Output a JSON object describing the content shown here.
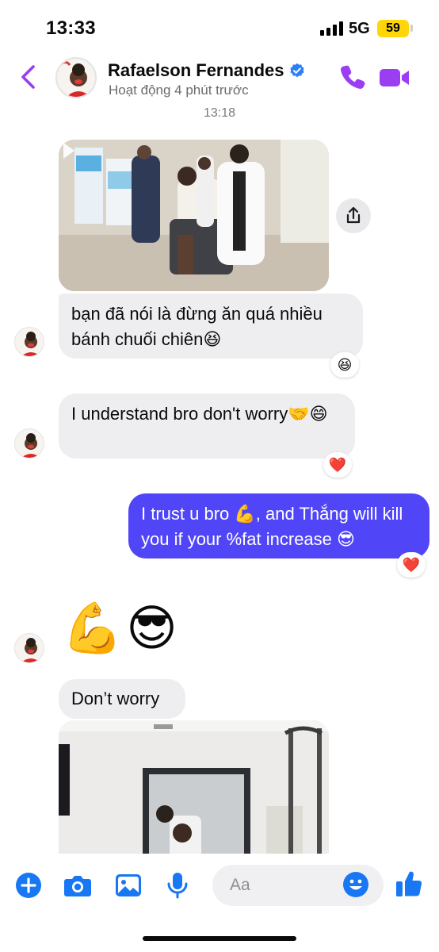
{
  "status_bar": {
    "time": "13:33",
    "network": "5G",
    "battery": "59"
  },
  "header": {
    "contact_name": "Rafaelson Fernandes",
    "presence": "Hoạt động 4 phút trước",
    "icons": [
      "chevron-left-icon",
      "verified-badge-icon",
      "phone-icon",
      "video-camera-icon"
    ]
  },
  "conversation": {
    "timestamp": "13:18",
    "messages": [
      {
        "type": "photo",
        "sender": "contact"
      },
      {
        "type": "text",
        "sender": "contact",
        "text": "bạn đã nói là đừng ăn quá nhiều bánh chuối chiên😆",
        "reaction": "😆"
      },
      {
        "type": "text",
        "sender": "contact",
        "text": "I understand bro don't worry🤝😄",
        "reaction": "❤️"
      },
      {
        "type": "text",
        "sender": "me",
        "text": "I trust u bro 💪, and Thắng will kill you if your %fat increase 😎",
        "reaction": "❤️"
      },
      {
        "type": "emoji",
        "sender": "contact",
        "text": "💪😎"
      },
      {
        "type": "text",
        "sender": "contact",
        "text": "Don’t worry"
      },
      {
        "type": "photo",
        "sender": "contact"
      }
    ]
  },
  "composer": {
    "placeholder": "Aa",
    "icons": [
      "plus-icon",
      "camera-icon",
      "image-icon",
      "microphone-icon",
      "emoji-icon",
      "thumbs-up-icon"
    ]
  },
  "colors": {
    "accent": "#5146f7",
    "icon_purple": "#9b3df0",
    "composer_blue": "#1877f2",
    "incoming_bubble": "#eeeef0"
  }
}
